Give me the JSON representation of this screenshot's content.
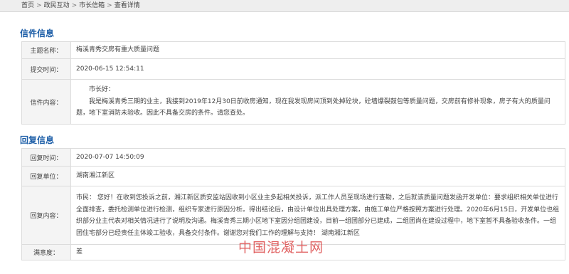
{
  "breadcrumb": {
    "items": [
      "首页",
      "政民互动",
      "市长信箱",
      "查看详情"
    ],
    "separator": ">"
  },
  "letter_section": {
    "title": "信件信息",
    "subject_label": "主题名称：",
    "subject_value": "梅溪青秀交房有重大质量问题",
    "time_label": "提交时间：",
    "time_value": "2020-06-15 12:54:11",
    "content_label": "信件内容：",
    "content_greeting": "市长好：",
    "content_body": "我是梅溪青秀三期的业主，我接到2019年12月30日前收房通知，现在我发现房间顶到处掉砼块，砼墙爆裂鼓包等质量问题，交房前有修补现象，房子有大的质量问题，地下室消防未验收。因此不具备交房的条件。请您查处。"
  },
  "reply_section": {
    "title": "回复信息",
    "time_label": "回复时间：",
    "time_value": "2020-07-07 14:50:09",
    "unit_label": "回复单位：",
    "unit_value": "湖南湘江新区",
    "content_label": "回复内容：",
    "content_value": "市民： 您好！在收到您投诉之前，湘江新区质安监站因收到小区业主多起相关投诉，派工作人员至现场进行查勘，之后就该质量问题发函开发单位：要求组织相关单位进行全面排查，委托检测单位进行检测，组织专家进行原因分析。得出结论后，由设计单位出具处理方案，由施工单位严格按照方案进行处理。2020年6月15日，开发单位也组织部分业主代表对相关情况进行了说明及沟通。梅溪青秀三期小区地下室因分组团建设，目前一组团部分已建成，二组团尚在建设过程中，地下室暂不具备验收条件。一组团住宅部分已经责任主体竣工验收，具备交付条件。谢谢您对我们工作的理解与支持！ 湖南湘江新区",
    "satisfaction_label": "满意度：",
    "satisfaction_value": "差"
  },
  "watermark": {
    "text": "中国混凝土网"
  },
  "colors": {
    "title_blue": "#1e5fa8",
    "label_bg": "#f4f4f4",
    "border": "#dcdcdc",
    "watermark_red": "#d62828"
  }
}
